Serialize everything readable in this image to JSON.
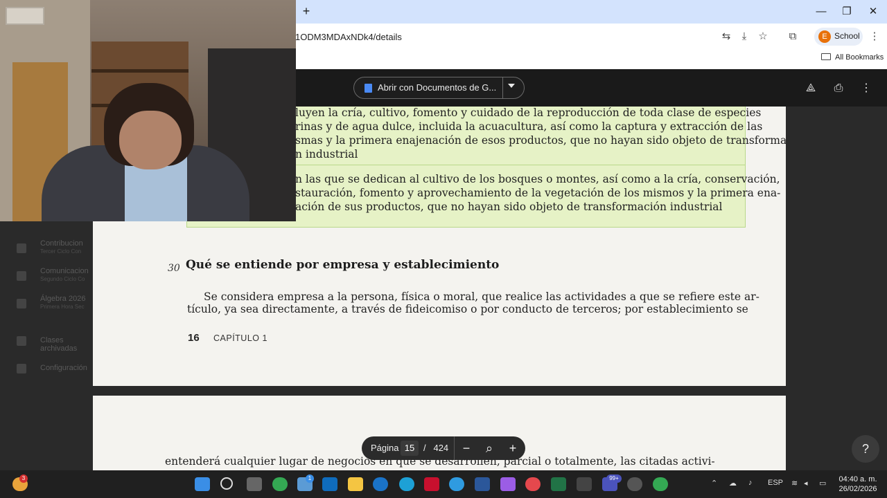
{
  "browser": {
    "url_fragment": "1ODM3MDAxNDk4/details",
    "profile_initial": "E",
    "profile_label": "School",
    "all_bookmarks": "All Bookmarks"
  },
  "viewer": {
    "open_with_label": "Abrir con Documentos de G...",
    "page_label": "Página",
    "current_page": "15",
    "page_separator": "/",
    "total_pages": "424"
  },
  "background_nav": [
    {
      "label": "Contribucion",
      "sub": "Tercer Ciclo Con"
    },
    {
      "label": "Comunicacion",
      "sub": "Segundo Ciclo Co"
    },
    {
      "label": "Álgebra 2026",
      "sub": "Primera Hora Sec"
    },
    {
      "label": "Clases archivadas",
      "sub": ""
    },
    {
      "label": "Configuración",
      "sub": ""
    }
  ],
  "document": {
    "highlight_lines_1": [
      "luyen la cría, cultivo, fomento y cuidado de la reproducción de toda clase de especies",
      "rinas y de agua dulce, incluida la acuacultura, así como la captura y extracción de las",
      "smas y la primera enajenación de esos productos, que no hayan sido objeto de transforma-",
      "n industrial"
    ],
    "highlight_lines_2": [
      "n las que se dedican al cultivo de los bosques o montes, así como a la cría, conservación,",
      "stauración, fomento y aprovechamiento de la vegetación de los mismos y la primera ena-",
      "ación de sus productos, que no hayan sido objeto de transformación industrial"
    ],
    "section_number": "30",
    "section_title": "Qué se entiende por empresa y establecimiento",
    "para_line_1": "Se considera empresa a la persona, física o moral, que realice las actividades a que se refiere este ar-",
    "para_line_2": "tículo, ya sea directamente, a través de fideicomiso o por conducto de terceros; por establecimiento se",
    "page_number": "16",
    "chapter_label": "CAPÍTULO 1",
    "next_page_line": "entenderá cualquier lugar de negocios en que se desarrollen, parcial o totalmente, las citadas activi-"
  },
  "taskbar": {
    "notif_count": "3",
    "mail_badge": "1",
    "teams_badge": "99+",
    "lang": "ESP",
    "time": "04:40 a. m.",
    "date": "26/02/2026"
  },
  "colors": {
    "highlight": "#e6f2c6",
    "chrome_tab_bar": "#d3e3fd",
    "profile_orange": "#e8710a"
  }
}
